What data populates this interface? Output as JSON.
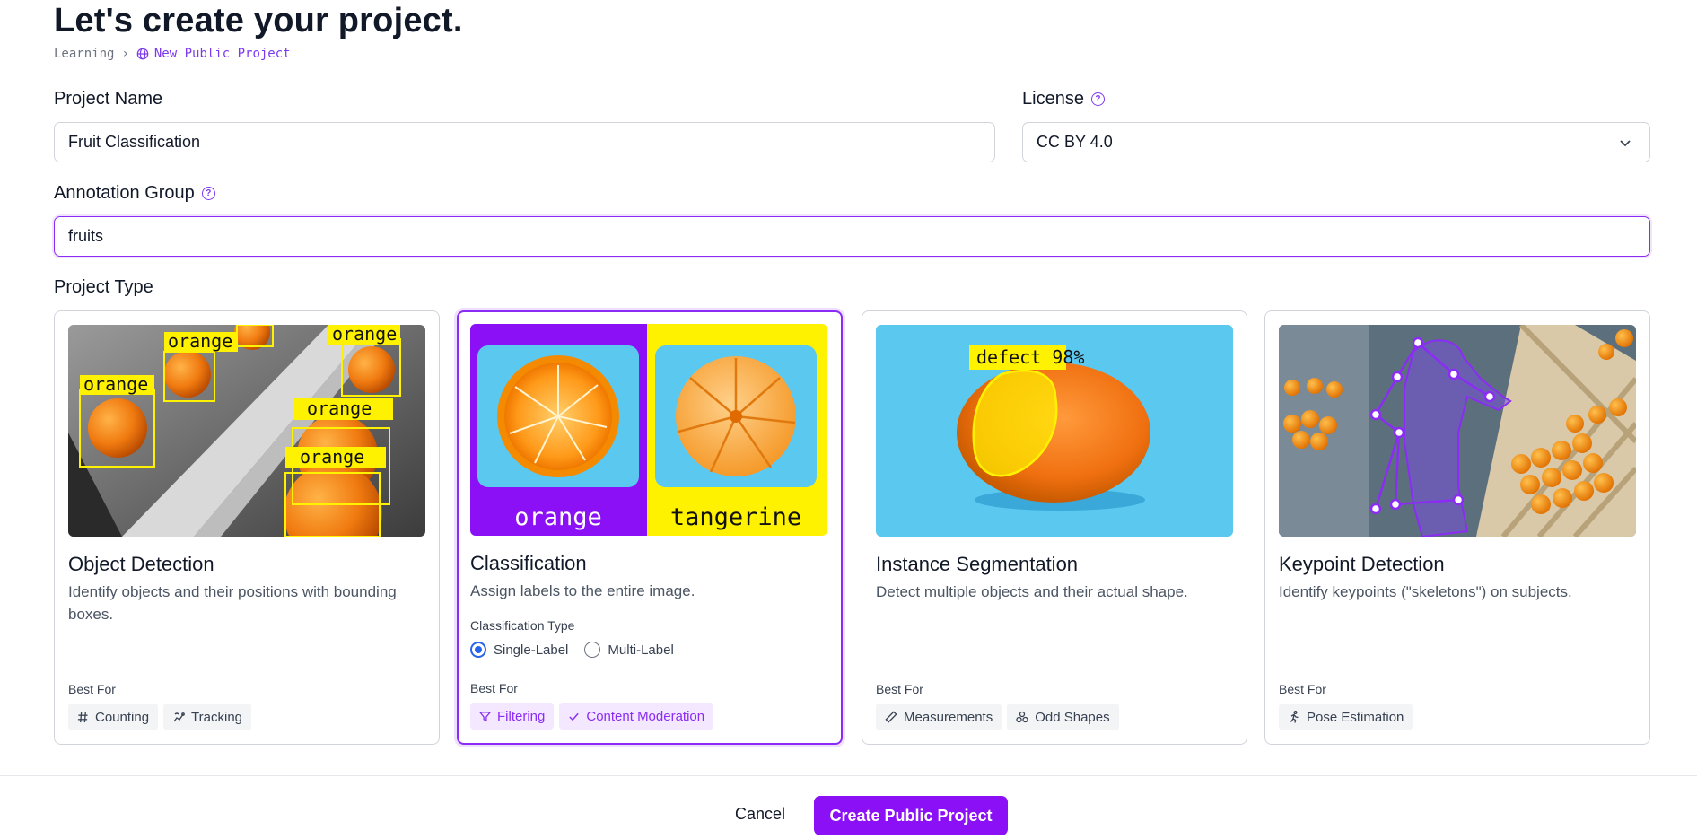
{
  "page": {
    "title": "Let's create your project."
  },
  "breadcrumb": {
    "parent": "Learning",
    "current": "New Public Project"
  },
  "fields": {
    "project_name": {
      "label": "Project Name",
      "value": "Fruit Classification"
    },
    "license": {
      "label": "License",
      "value": "CC BY 4.0"
    },
    "annotation_group": {
      "label": "Annotation Group",
      "value": "fruits"
    }
  },
  "project_type": {
    "label": "Project Type",
    "cards": [
      {
        "title": "Object Detection",
        "description": "Identify objects and their positions with bounding boxes.",
        "best_for_label": "Best For",
        "image_labels": [
          "orange",
          "orange",
          "orange",
          "orange",
          "orange"
        ],
        "tags": [
          {
            "label": "Counting",
            "icon": "hash-icon"
          },
          {
            "label": "Tracking",
            "icon": "tracking-icon"
          }
        ]
      },
      {
        "title": "Classification",
        "description": "Assign labels to the entire image.",
        "selected": true,
        "classification_type_label": "Classification Type",
        "options": [
          {
            "label": "Single-Label",
            "checked": true
          },
          {
            "label": "Multi-Label",
            "checked": false
          }
        ],
        "best_for_label": "Best For",
        "image_labels": [
          "orange",
          "tangerine"
        ],
        "tags": [
          {
            "label": "Filtering",
            "icon": "filter-icon"
          },
          {
            "label": "Content Moderation",
            "icon": "check-icon"
          }
        ]
      },
      {
        "title": "Instance Segmentation",
        "description": "Detect multiple objects and their actual shape.",
        "best_for_label": "Best For",
        "image_labels": [
          "defect 98%"
        ],
        "tags": [
          {
            "label": "Measurements",
            "icon": "ruler-icon"
          },
          {
            "label": "Odd Shapes",
            "icon": "shapes-icon"
          }
        ]
      },
      {
        "title": "Keypoint Detection",
        "description": "Identify keypoints (\"skeletons\") on subjects.",
        "best_for_label": "Best For",
        "tags": [
          {
            "label": "Pose Estimation",
            "icon": "running-person-icon"
          }
        ]
      }
    ]
  },
  "footer": {
    "cancel_label": "Cancel",
    "create_label": "Create Public Project"
  },
  "colors": {
    "accent": "#8b10f5",
    "selected_border": "#8b2cf5",
    "radio": "#2563eb",
    "label_yellow": "#fff200"
  }
}
